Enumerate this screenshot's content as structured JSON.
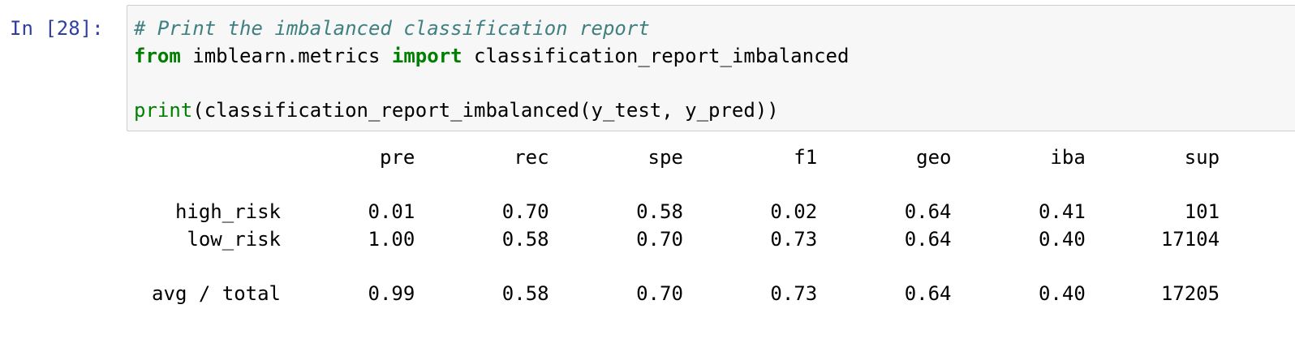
{
  "cell": {
    "prompt": "In [28]:",
    "code": {
      "comment": "# Print the imbalanced classification report",
      "line2": {
        "kw_from": "from",
        "module": " imblearn.metrics ",
        "kw_import": "import",
        "name": " classification_report_imbalanced"
      },
      "line4": {
        "builtin_print": "print",
        "call": "(classification_report_imbalanced(y_test, y_pred))"
      }
    }
  },
  "output": {
    "headers": [
      "pre",
      "rec",
      "spe",
      "f1",
      "geo",
      "iba",
      "sup"
    ],
    "rows": [
      {
        "label": "high_risk",
        "values": [
          "0.01",
          "0.70",
          "0.58",
          "0.02",
          "0.64",
          "0.41",
          "101"
        ]
      },
      {
        "label": "low_risk",
        "values": [
          "1.00",
          "0.58",
          "0.70",
          "0.73",
          "0.64",
          "0.40",
          "17104"
        ]
      }
    ],
    "total": {
      "label": "avg / total",
      "values": [
        "0.99",
        "0.58",
        "0.70",
        "0.73",
        "0.64",
        "0.40",
        "17205"
      ]
    }
  },
  "colors": {
    "prompt": "#303f9f",
    "comment": "#408080",
    "keyword": "#008000",
    "input_background": "#f7f7f7",
    "input_border": "#cfcfcf"
  }
}
